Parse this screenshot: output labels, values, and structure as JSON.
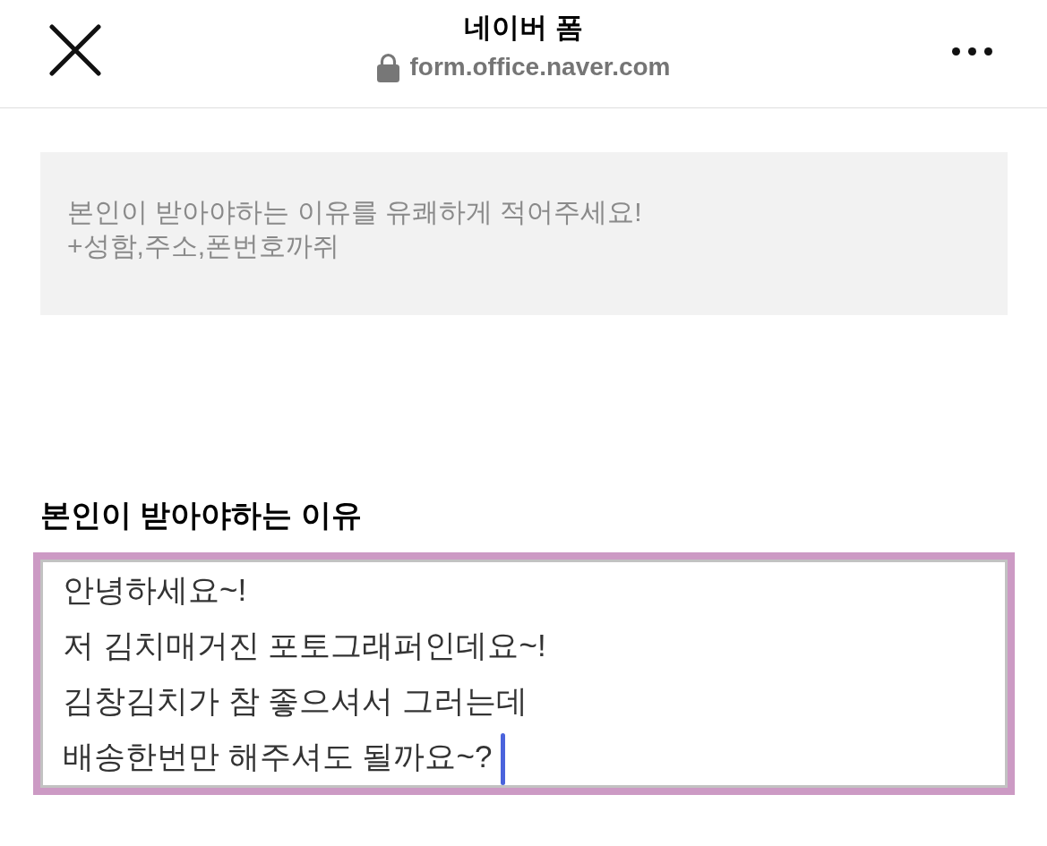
{
  "header": {
    "title": "네이버 폼",
    "secure": true,
    "url": "form.office.naver.com"
  },
  "description": {
    "lines": [
      "본인이 받아야하는 이유를 유쾌하게 적어주세요!",
      "+성함,주소,폰번호까쥐"
    ]
  },
  "question": {
    "label": "본인이 받아야하는 이유",
    "answer": {
      "focused": true,
      "lines": [
        "안녕하세요~!",
        "저 김치매거진 포토그래퍼인데요~!",
        "김창김치가 참 좋으셔서 그러는데",
        "배송한번만 해주셔도 될까요~?"
      ]
    }
  }
}
